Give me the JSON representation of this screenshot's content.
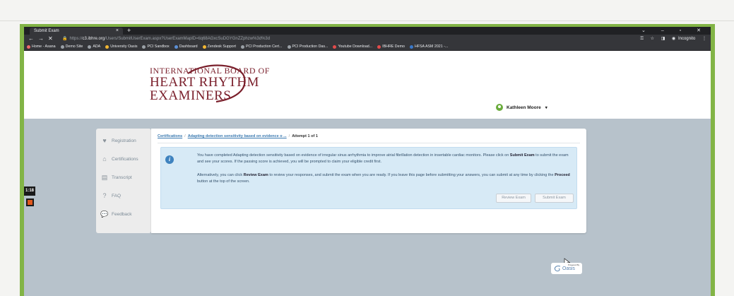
{
  "browser": {
    "tab_title": "Submit Exam",
    "tab_close": "×",
    "new_tab": "+",
    "window_controls": "⌄ – ▫ ✕",
    "nav": {
      "back": "←",
      "forward": "→",
      "stop": "✕"
    },
    "url_prefix": "https://",
    "url_host": "c3.ibhre.org",
    "url_path": "/Users/SubmitUserExam.aspx?UserExamMapID=tiq68AGxcSuDGYGnZZphzw%3d%3d",
    "incognito_label": "Incognito",
    "bookmarks": [
      {
        "label": "Home - Asana",
        "color": "#f06a6a"
      },
      {
        "label": "Demo Site",
        "color": "#9aa0a6"
      },
      {
        "label": "ADA",
        "color": "#9aa0a6"
      },
      {
        "label": "University Oasis",
        "color": "#f2b632"
      },
      {
        "label": "PCI Sandbox",
        "color": "#9aa0a6"
      },
      {
        "label": "Dashboard",
        "color": "#5b8fd6"
      },
      {
        "label": "Zendesk Support",
        "color": "#f2b632"
      },
      {
        "label": "PCI Production Cert...",
        "color": "#9aa0a6"
      },
      {
        "label": "PCI Production Das...",
        "color": "#9aa0a6"
      },
      {
        "label": "Youtube Download...",
        "color": "#e24b4b"
      },
      {
        "label": "IBHRE Demo",
        "color": "#e24b4b"
      },
      {
        "label": "HFSA ASM 2021 -...",
        "color": "#3a78c9"
      }
    ]
  },
  "logo": {
    "line1": "INTERNATIONAL BOARD OF",
    "line2": "HEART RHYTHM",
    "line3": "EXAMINERS"
  },
  "user": {
    "name": "Kathleen Moore",
    "caret": "▾"
  },
  "sidebar": {
    "items": [
      {
        "label": "Registration",
        "icon": "heart-icon"
      },
      {
        "label": "Certifications",
        "icon": "home-icon"
      },
      {
        "label": "Transcript",
        "icon": "transcript-icon"
      },
      {
        "label": "FAQ",
        "icon": "question-icon"
      },
      {
        "label": "Feedback",
        "icon": "chat-icon"
      }
    ]
  },
  "breadcrumb": {
    "certifications": "Certifications",
    "sep1": "/",
    "course": "Adapting detection sensitivity based on evidence o ...",
    "sep2": "/",
    "attempt": "Attempt 1 of 1"
  },
  "alert": {
    "p1_before": "You have completed Adapting detection sensitivity based on evidence of irregular sinus arrhythmia to improve atrial fibrillation detection in insertable cardiac monitors. Please click on ",
    "p1_bold": "Submit Exam",
    "p1_after": " to submit the exam and see your scores. If the passing score is achieved, you will be prompted to claim your eligible credit first.",
    "p2_a": "Alternatively, you can click ",
    "p2_bold1": "Review Exam",
    "p2_b": " to review your responses, and submit the exam when you are ready. If you leave this page before submitting your answers, you can submit at any time by clicking the ",
    "p2_bold2": "Proceed",
    "p2_c": " button at the top of the screen."
  },
  "buttons": {
    "review": "Review Exam",
    "submit": "Submit Exam"
  },
  "oasis": {
    "powered": "Powered By",
    "word": "Oasis"
  },
  "recording": {
    "timer": "1:18"
  },
  "colors": {
    "frame": "#82b446",
    "brand": "#7a1f2b",
    "info": "#3f83bf",
    "link": "#3a79b0"
  }
}
